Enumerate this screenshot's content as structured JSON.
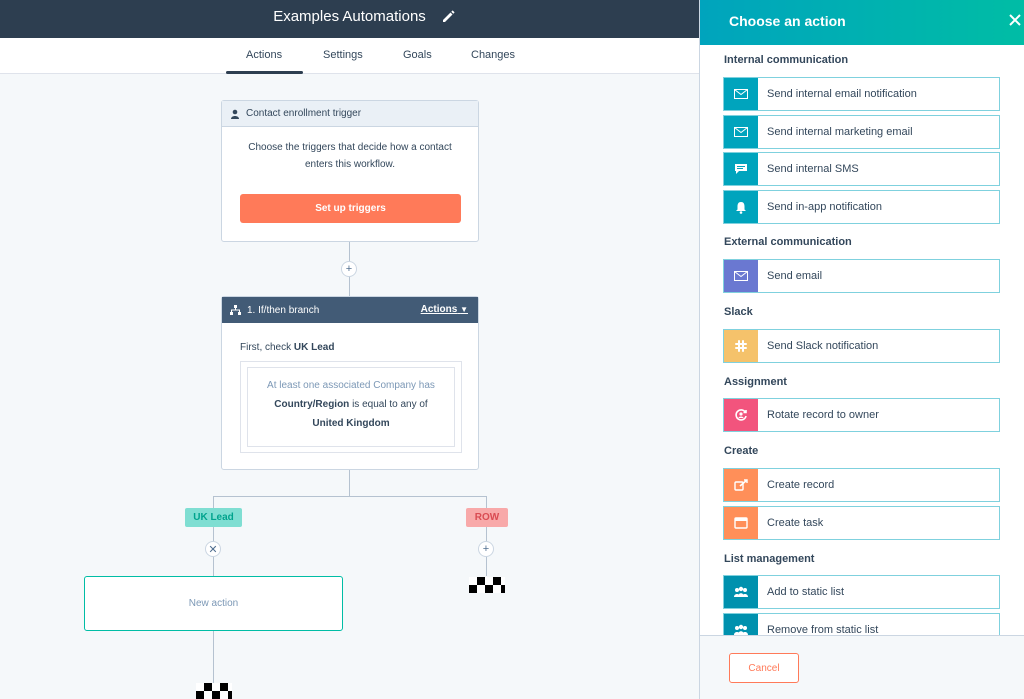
{
  "header": {
    "title": "Examples Automations",
    "edit_icon": "pencil-icon"
  },
  "tabs": [
    {
      "label": "Actions",
      "active": true
    },
    {
      "label": "Settings",
      "active": false
    },
    {
      "label": "Goals",
      "active": false
    },
    {
      "label": "Changes",
      "active": false
    }
  ],
  "trigger_card": {
    "header": "Contact enrollment trigger",
    "description": "Choose the triggers that decide how a contact enters this workflow.",
    "button": "Set up triggers"
  },
  "branch_card": {
    "header": "1. If/then branch",
    "actions_label": "Actions",
    "first_check_prefix": "First, check",
    "first_check_value": "UK Lead",
    "criteria_line1": "At least one associated Company has",
    "criteria_field": "Country/Region",
    "criteria_operator": "is equal to any of",
    "criteria_value": "United Kingdom"
  },
  "branches": {
    "left": "UK Lead",
    "right": "ROW"
  },
  "new_action": "New action",
  "panel": {
    "title": "Choose an action",
    "sections": [
      {
        "title": "Internal communication",
        "items": [
          {
            "label": "Send internal email notification",
            "icon": "envelope-icon",
            "color": "#00a4bd"
          },
          {
            "label": "Send internal marketing email",
            "icon": "envelope-icon",
            "color": "#00a4bd"
          },
          {
            "label": "Send internal SMS",
            "icon": "chat-icon",
            "color": "#00a4bd"
          },
          {
            "label": "Send in-app notification",
            "icon": "bell-icon",
            "color": "#00a4bd"
          }
        ]
      },
      {
        "title": "External communication",
        "items": [
          {
            "label": "Send email",
            "icon": "envelope-icon",
            "color": "#6a78d1"
          }
        ]
      },
      {
        "title": "Slack",
        "items": [
          {
            "label": "Send Slack notification",
            "icon": "slack-icon",
            "color": "#f5c26b"
          }
        ]
      },
      {
        "title": "Assignment",
        "items": [
          {
            "label": "Rotate record to owner",
            "icon": "rotate-owner-icon",
            "color": "#f2547d"
          }
        ]
      },
      {
        "title": "Create",
        "items": [
          {
            "label": "Create record",
            "icon": "create-record-icon",
            "color": "#ff8f59"
          },
          {
            "label": "Create task",
            "icon": "task-icon",
            "color": "#ff8f59"
          }
        ]
      },
      {
        "title": "List management",
        "items": [
          {
            "label": "Add to static list",
            "icon": "people-icon",
            "color": "#0091ae"
          },
          {
            "label": "Remove from static list",
            "icon": "people-icon",
            "color": "#0091ae"
          }
        ]
      }
    ],
    "cancel": "Cancel"
  }
}
